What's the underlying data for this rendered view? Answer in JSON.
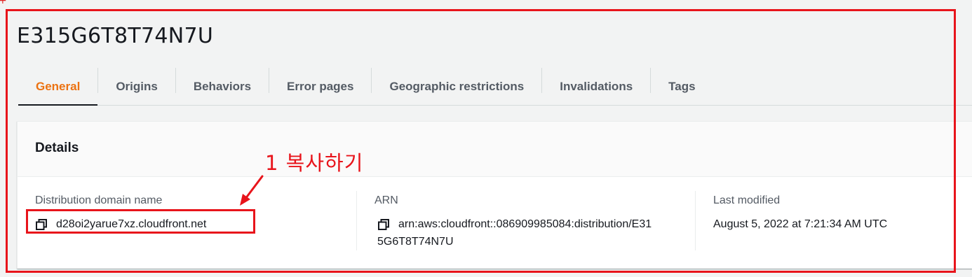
{
  "page_marker": "+",
  "distribution": {
    "id": "E315G6T8T74N7U"
  },
  "tabs": [
    {
      "label": "General",
      "active": true
    },
    {
      "label": "Origins",
      "active": false
    },
    {
      "label": "Behaviors",
      "active": false
    },
    {
      "label": "Error pages",
      "active": false
    },
    {
      "label": "Geographic restrictions",
      "active": false
    },
    {
      "label": "Invalidations",
      "active": false
    },
    {
      "label": "Tags",
      "active": false
    }
  ],
  "details": {
    "title": "Details",
    "domain_name": {
      "label": "Distribution domain name",
      "value": "d28oi2yarue7xz.cloudfront.net",
      "icon": "copy-icon"
    },
    "arn": {
      "label": "ARN",
      "value": "arn:aws:cloudfront::086909985084:distribution/E315G6T8T74N7U",
      "icon": "copy-icon"
    },
    "last_modified": {
      "label": "Last modified",
      "value": "August 5, 2022 at 7:21:34 AM UTC"
    }
  },
  "annotation": {
    "text": "1 복사하기",
    "color": "#e8141b"
  },
  "colors": {
    "accent_active_tab": "#ec7211",
    "text_primary": "#16191f",
    "text_secondary": "#545b64",
    "annotation_red": "#e8141b"
  }
}
